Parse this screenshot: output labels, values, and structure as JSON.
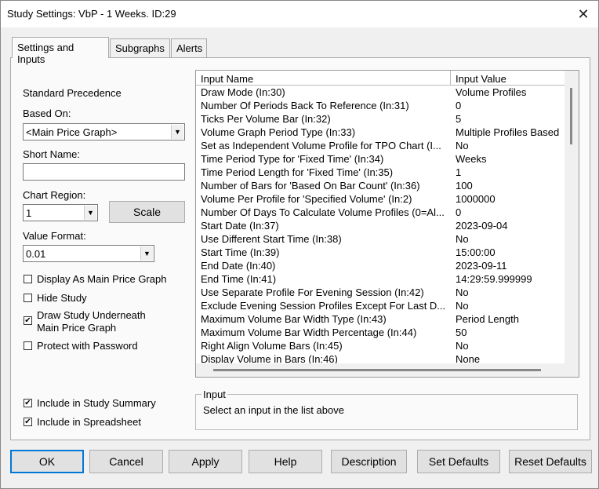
{
  "window": {
    "title": "Study Settings: VbP - 1 Weeks. ID:29"
  },
  "tabs": [
    {
      "label": "Settings and Inputs",
      "active": true
    },
    {
      "label": "Subgraphs",
      "active": false
    },
    {
      "label": "Alerts",
      "active": false
    }
  ],
  "left": {
    "standard_precedence": "Standard Precedence",
    "based_on_label": "Based On:",
    "based_on_value": "<Main Price Graph>",
    "short_name_label": "Short Name:",
    "short_name_value": "",
    "chart_region_label": "Chart Region:",
    "chart_region_value": "1",
    "scale_button": "Scale",
    "value_format_label": "Value Format:",
    "value_format_value": "0.01",
    "checkboxes": [
      {
        "label": "Display As Main Price Graph",
        "checked": false
      },
      {
        "label": "Hide Study",
        "checked": false
      },
      {
        "label": "Draw Study Underneath",
        "label2": "Main Price Graph",
        "checked": true
      },
      {
        "label": "Protect with Password",
        "checked": false
      },
      {
        "label": "Include in Study Summary",
        "checked": true
      },
      {
        "label": "Include in Spreadsheet",
        "checked": true
      }
    ]
  },
  "grid": {
    "headers": {
      "name": "Input Name",
      "value": "Input Value"
    },
    "rows": [
      {
        "name": "Draw Mode  (In:30)",
        "value": "Volume Profiles"
      },
      {
        "name": "Number Of Periods Back To Reference  (In:31)",
        "value": "0"
      },
      {
        "name": "Ticks Per Volume Bar  (In:32)",
        "value": "5"
      },
      {
        "name": "Volume Graph Period Type  (In:33)",
        "value": "Multiple Profiles Based"
      },
      {
        "name": "Set as Independent Volume Profile for TPO Chart  (I...",
        "value": "No"
      },
      {
        "name": "Time Period Type for 'Fixed Time'  (In:34)",
        "value": "Weeks"
      },
      {
        "name": "Time Period Length for 'Fixed Time'  (In:35)",
        "value": "1"
      },
      {
        "name": "Number of Bars for 'Based On Bar Count'  (In:36)",
        "value": "100"
      },
      {
        "name": "Volume Per Profile for 'Specified Volume'  (In:2)",
        "value": "1000000"
      },
      {
        "name": "Number Of Days To Calculate Volume Profiles (0=Al...",
        "value": "0"
      },
      {
        "name": "Start Date  (In:37)",
        "value": "2023-09-04"
      },
      {
        "name": "Use Different Start Time  (In:38)",
        "value": "No"
      },
      {
        "name": "Start Time  (In:39)",
        "value": "15:00:00"
      },
      {
        "name": "End Date  (In:40)",
        "value": "2023-09-11"
      },
      {
        "name": "End Time  (In:41)",
        "value": "14:29:59.999999"
      },
      {
        "name": "Use Separate Profile For Evening Session  (In:42)",
        "value": "No"
      },
      {
        "name": "Exclude Evening Session Profiles Except For Last D...",
        "value": "No"
      },
      {
        "name": "Maximum Volume Bar Width Type  (In:43)",
        "value": "Period Length"
      },
      {
        "name": "Maximum Volume Bar Width Percentage  (In:44)",
        "value": "50"
      },
      {
        "name": "Right Align Volume Bars  (In:45)",
        "value": "No"
      },
      {
        "name": "Display Volume in Bars  (In:46)",
        "value": "None"
      }
    ]
  },
  "input_group": {
    "title": "Input",
    "text": "Select an input in the list above"
  },
  "buttons": {
    "ok": "OK",
    "cancel": "Cancel",
    "apply": "Apply",
    "help": "Help",
    "description": "Description",
    "set_defaults": "Set Defaults",
    "reset_defaults": "Reset Defaults"
  },
  "colors": {
    "focus_border": "#0078d7",
    "dialog_bg": "#f0f0f0",
    "panel_bg": "#fafafa"
  }
}
